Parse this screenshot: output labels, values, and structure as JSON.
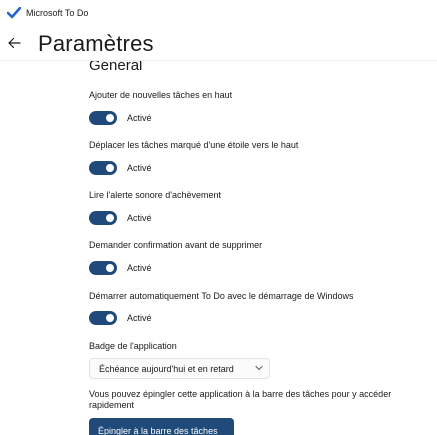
{
  "app": {
    "title": "Microsoft To Do"
  },
  "header": {
    "title": "Paramètres"
  },
  "general": {
    "title": "Général",
    "settings": [
      {
        "label": "Ajouter de nouvelles tâches en haut",
        "state": "Activé",
        "on": true
      },
      {
        "label": "Déplacer les tâches marqué d'une étoile vers le haut",
        "state": "Activé",
        "on": true
      },
      {
        "label": "Lire l'alerte sonore d'achèvement",
        "state": "Activé",
        "on": true
      },
      {
        "label": "Demander confirmation avant de supprimer",
        "state": "Activé",
        "on": true
      },
      {
        "label": "Démarrer automatiquement To Do avec le démarrage de Windows",
        "state": "Activé",
        "on": true
      }
    ],
    "badge": {
      "label": "Badge de l'application",
      "value": "Échéance aujourd'hui et en retard"
    },
    "pin": {
      "description": "Vous pouvez épingler cette application à la barre des tâches pour y accéder rapidement",
      "button": "Épingler à la barre des tâches"
    }
  },
  "colors": {
    "accent": "#1f4a7a",
    "logo": "#2564cf"
  }
}
